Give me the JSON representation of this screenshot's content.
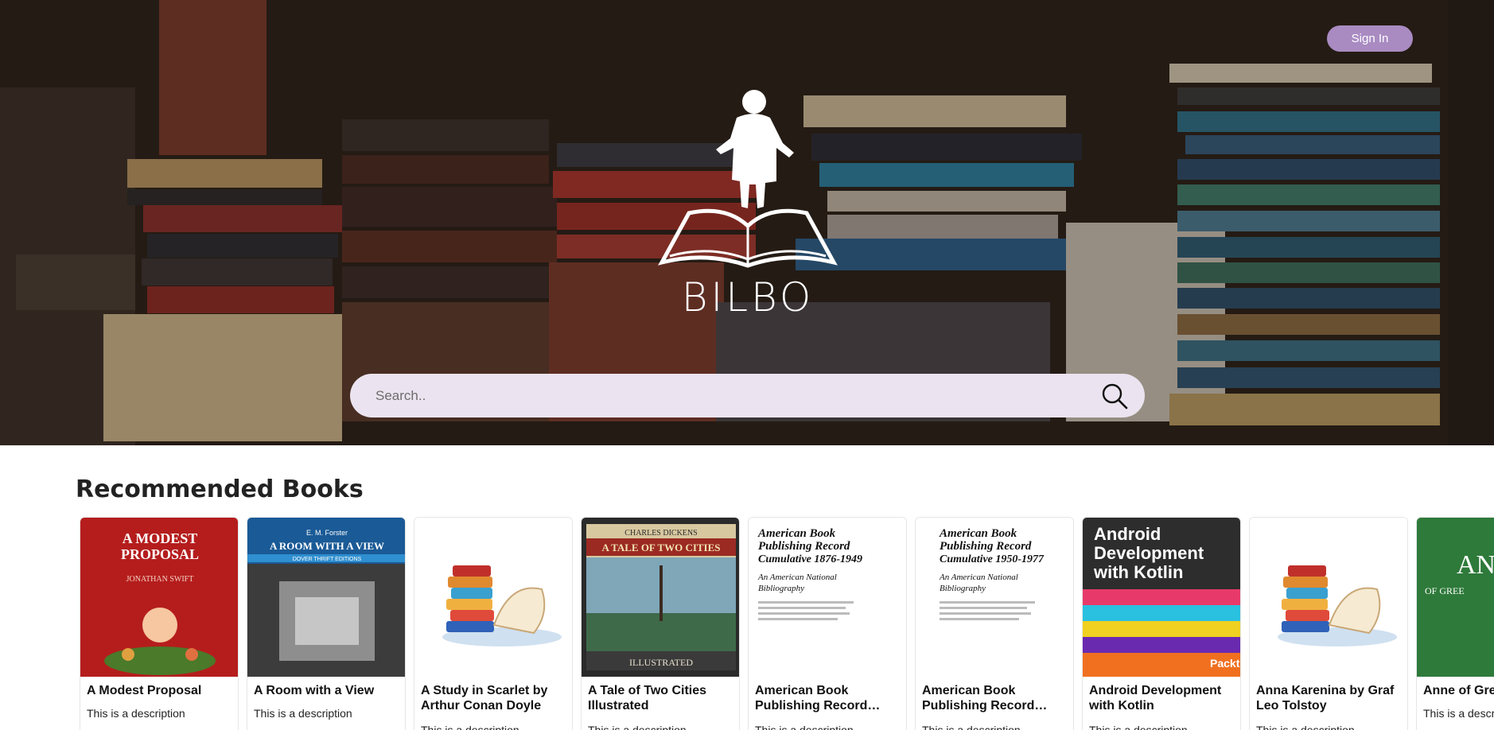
{
  "header": {
    "sign_in_label": "Sign In",
    "brand": "BILBO"
  },
  "search": {
    "placeholder": "Search.."
  },
  "recommended": {
    "title": "Recommended Books",
    "books": [
      {
        "title": "A Modest Proposal",
        "description": "This is a description",
        "cover_text": [
          "A MODEST",
          "PROPOSAL",
          "JONATHAN SWIFT"
        ]
      },
      {
        "title": "A Room with a View",
        "description": "This is a description",
        "cover_text": [
          "E. M. Forster",
          "A ROOM WITH A VIEW",
          "DOVER THRIFT EDITIONS"
        ]
      },
      {
        "title": "A Study in Scarlet by Arthur Conan Doyle",
        "description": "This is a description"
      },
      {
        "title": "A Tale of Two Cities Illustrated",
        "description": "This is a description",
        "cover_text": [
          "CHARLES DICKENS",
          "A TALE OF TWO CITIES",
          "ILLUSTRATED"
        ]
      },
      {
        "title": "American Book Publishing Record…",
        "description": "This is a description",
        "cover_text": [
          "American Book",
          "Publishing Record",
          "Cumulative 1876-1949",
          "An American National",
          "Bibliography"
        ]
      },
      {
        "title": "American Book Publishing Record…",
        "description": "This is a description",
        "cover_text": [
          "American Book",
          "Publishing Record",
          "Cumulative 1950-1977",
          "An American National",
          "Bibliography"
        ]
      },
      {
        "title": "Android Development with Kotlin",
        "description": "This is a description",
        "cover_text": [
          "Android",
          "Development",
          "with Kotlin",
          "Packt"
        ]
      },
      {
        "title": "Anna Karenina by Graf Leo Tolstoy",
        "description": "This is a description"
      },
      {
        "title": "Anne of Gree",
        "description": "This is a descri",
        "cover_text": [
          "AN",
          "OF GREE"
        ]
      }
    ]
  },
  "colors": {
    "accent": "#a98bc2",
    "search_bg": "#ebe3ef"
  },
  "icons": [
    "search-icon",
    "bilbo-logo-icon",
    "book-stack-placeholder-icon"
  ]
}
